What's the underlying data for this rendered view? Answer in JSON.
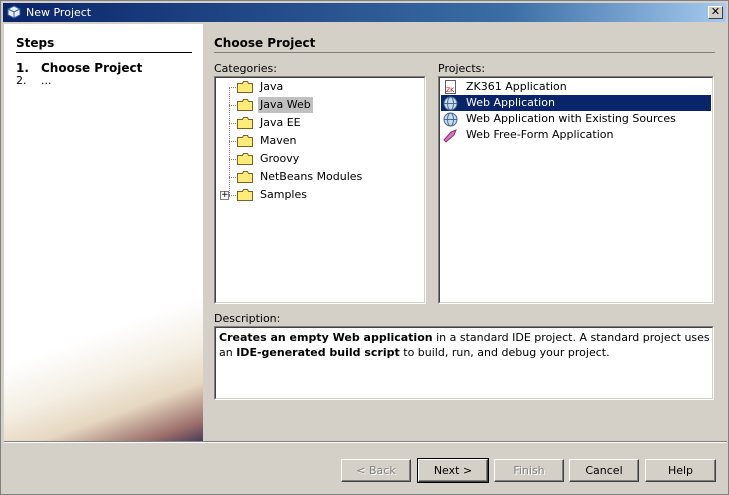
{
  "window": {
    "title": "New Project",
    "close_label": "✕"
  },
  "steps": {
    "heading": "Steps",
    "items": [
      {
        "num": "1.",
        "label": "Choose Project"
      },
      {
        "num": "2.",
        "label": "..."
      }
    ]
  },
  "main": {
    "heading": "Choose Project",
    "categories_label": "Categories:",
    "projects_label": "Projects:",
    "description_label": "Description:",
    "categories": [
      "Java",
      "Java Web",
      "Java EE",
      "Maven",
      "Groovy",
      "NetBeans Modules",
      "Samples"
    ],
    "selected_category": "Java Web",
    "projects": [
      {
        "label": "ZK361 Application",
        "icon": "zk-project-icon"
      },
      {
        "label": "Web Application",
        "icon": "globe-icon"
      },
      {
        "label": "Web Application with Existing Sources",
        "icon": "globe-icon"
      },
      {
        "label": "Web Free-Form Application",
        "icon": "freeform-icon"
      }
    ],
    "selected_project": "Web Application",
    "description": {
      "bold1": "Creates an empty Web application",
      "text1": " in a standard IDE project. A standard project uses an ",
      "bold2": "IDE-generated build script",
      "text2": " to build, run, and debug your project."
    }
  },
  "buttons": {
    "back": "< Back",
    "next": "Next >",
    "finish": "Finish",
    "cancel": "Cancel",
    "help": "Help"
  },
  "colors": {
    "selection": "#0a246a",
    "titlebar": "#0a246a",
    "face": "#d4d0c8"
  }
}
